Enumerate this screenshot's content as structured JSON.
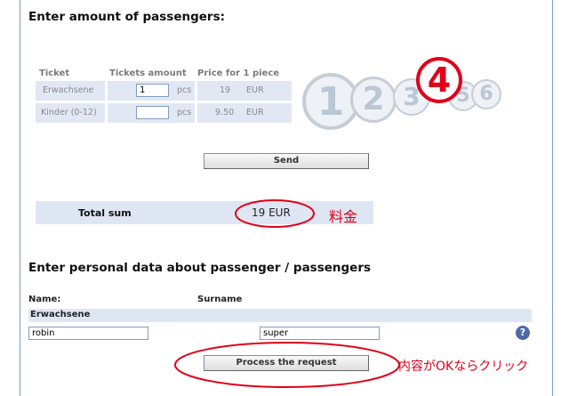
{
  "section1": {
    "title": "Enter amount of passengers:"
  },
  "tickets": {
    "headers": {
      "ticket": "Ticket",
      "amount": "Tickets amount",
      "price": "Price for 1 piece"
    },
    "rows": [
      {
        "label": "Erwachsene",
        "value": "1",
        "unit": "pcs",
        "price": "19",
        "currency": "EUR"
      },
      {
        "label": "Kinder (0-12)",
        "value": "",
        "unit": "pcs",
        "price": "9.50",
        "currency": "EUR"
      }
    ]
  },
  "steps": {
    "numbers": [
      "1",
      "2",
      "3",
      "4",
      "5",
      "6"
    ],
    "active": "4"
  },
  "send_label": "Send",
  "total": {
    "label": "Total sum",
    "value": "19 EUR",
    "annotation": "料金"
  },
  "section2": {
    "title": "Enter personal data about passenger / passengers"
  },
  "personal": {
    "name_label": "Name:",
    "surname_label": "Surname",
    "group_label": "Erwachsene",
    "name_value": "robin",
    "surname_value": "super"
  },
  "process_label": "Process the request",
  "process_annotation": "内容がOKならクリック",
  "colors": {
    "accent_red": "#e0001a",
    "row_bg": "#e1e7f3",
    "frame": "#7a9bc5"
  }
}
